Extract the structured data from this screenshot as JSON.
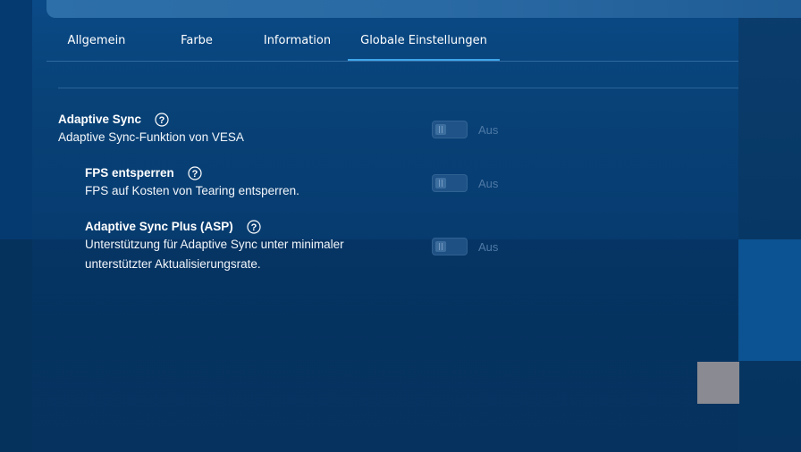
{
  "tabs": [
    {
      "label": "Allgemein",
      "active": false
    },
    {
      "label": "Farbe",
      "active": false
    },
    {
      "label": "Information",
      "active": false
    },
    {
      "label": "Globale Einstellungen",
      "active": true
    }
  ],
  "settings": [
    {
      "title": "Adaptive Sync",
      "description": "Adaptive Sync-Funktion von VESA",
      "toggle_state": "Aus",
      "help_icon": "question-circle-icon"
    },
    {
      "title": "FPS entsperren",
      "description": "FPS auf Kosten von Tearing entsperren.",
      "toggle_state": "Aus",
      "help_icon": "question-circle-icon"
    },
    {
      "title": "Adaptive Sync Plus (ASP)",
      "description_line1": "Unterstützung für Adaptive Sync unter minimaler",
      "description_line2": "unterstützter Aktualisierungsrate.",
      "toggle_state": "Aus",
      "help_icon": "question-circle-icon"
    }
  ],
  "colors": {
    "accent": "#3ea6ea",
    "background": "#084277",
    "disabled_text": "#4e79a6"
  }
}
